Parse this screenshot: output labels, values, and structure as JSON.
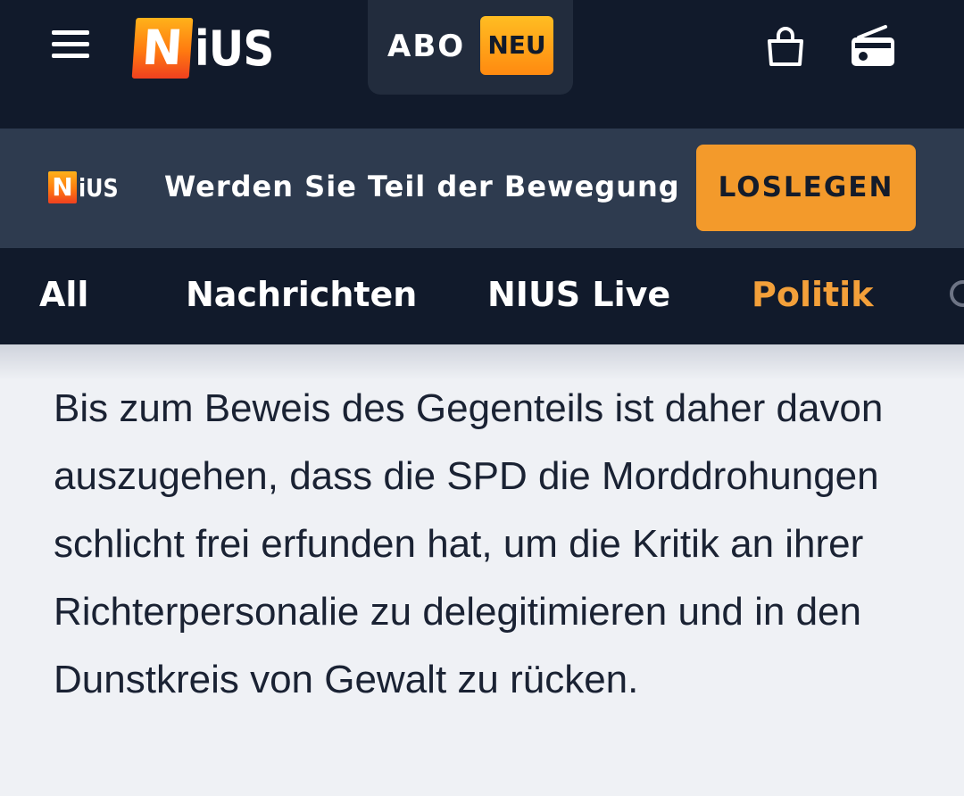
{
  "header": {
    "logo_text_1": "N",
    "logo_text_2": "iUS",
    "abo_label": "ABO",
    "neu_badge": "NEU",
    "menu_icon": "hamburger-menu-icon",
    "bag_icon": "shopping-bag-icon",
    "radio_icon": "radio-icon"
  },
  "promo": {
    "logo_text_1": "N",
    "logo_text_2": "iUS",
    "text": "Werden Sie Teil der Bewegung",
    "cta_label": "LOSLEGEN"
  },
  "nav": {
    "tabs": [
      {
        "label": "All",
        "active": false
      },
      {
        "label": "Nachrichten",
        "active": false
      },
      {
        "label": "NIUS Live",
        "active": false
      },
      {
        "label": "Politik",
        "active": true
      }
    ]
  },
  "article": {
    "paragraph": "Bis zum Beweis des Gegenteils ist daher davon auszugehen, dass die SPD die Morddrohungen schlicht frei erfunden hat, um die Kritik an ihrer Richterpersonalie zu delegitimieren und in den Dunstkreis von Gewalt zu rücken."
  },
  "colors": {
    "header_bg": "#111a2b",
    "promo_bg": "#2e3b4f",
    "accent_orange": "#f39a2b",
    "active_tab": "#f3a03a",
    "content_bg": "#eff1f5",
    "text_dark": "#1a2233"
  }
}
